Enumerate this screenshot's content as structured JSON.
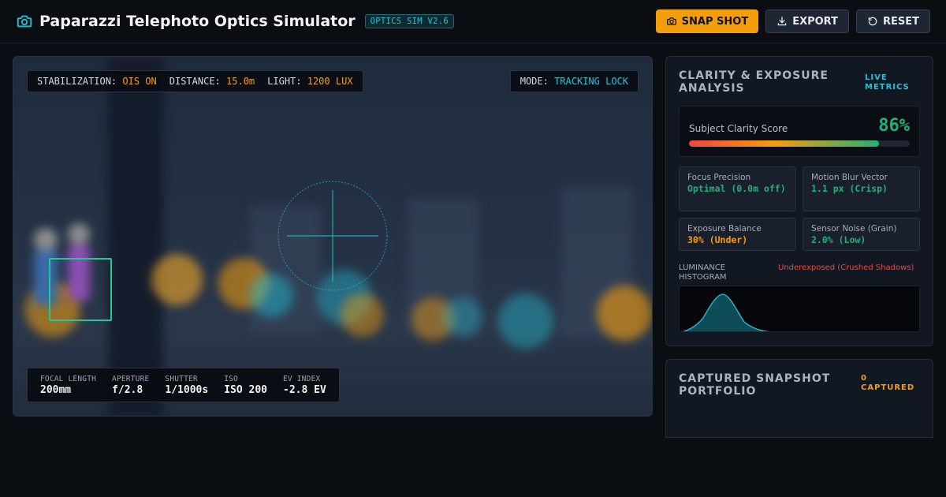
{
  "header": {
    "title": "Paparazzi Telephoto Optics Simulator",
    "version_badge": "OPTICS SIM V2.6",
    "buttons": {
      "snap": "SNAP SHOT",
      "export": "EXPORT",
      "reset": "RESET"
    }
  },
  "viewfinder": {
    "hud_top": {
      "stabilization_label": "STABILIZATION:",
      "stabilization_value": "OIS ON",
      "distance_label": "DISTANCE:",
      "distance_value": "15.0m",
      "light_label": "LIGHT:",
      "light_value": "1200 LUX"
    },
    "mode": {
      "label": "MODE:",
      "value": "TRACKING LOCK"
    },
    "exposure": [
      {
        "label": "FOCAL LENGTH",
        "value": "200mm"
      },
      {
        "label": "APERTURE",
        "value": "f/2.8"
      },
      {
        "label": "SHUTTER",
        "value": "1/1000s"
      },
      {
        "label": "ISO",
        "value": "ISO 200"
      },
      {
        "label": "EV INDEX",
        "value": "-2.8 EV"
      }
    ]
  },
  "analysis": {
    "title": "CLARITY & EXPOSURE ANALYSIS",
    "tag": "LIVE METRICS",
    "clarity_label": "Subject Clarity Score",
    "clarity_value": "86%",
    "clarity_fraction": 0.86,
    "metrics": [
      {
        "label": "Focus Precision",
        "value": "Optimal (0.0m off)",
        "color": "#22b07a"
      },
      {
        "label": "Motion Blur Vector",
        "value": "1.1 px (Crisp)",
        "color": "#22b07a"
      },
      {
        "label": "Exposure Balance",
        "value": "30% (Under)",
        "color": "#f59e0b"
      },
      {
        "label": "Sensor Noise (Grain)",
        "value": "2.0% (Low)",
        "color": "#22b07a"
      }
    ],
    "histogram_label": "LUMINANCE HISTOGRAM",
    "histogram_status": "Underexposed (Crushed Shadows)"
  },
  "portfolio": {
    "title": "CAPTURED SNAPSHOT PORTFOLIO",
    "count": "0 CAPTURED"
  },
  "colors": {
    "accent": "#f59e0b",
    "cyan": "#22c3d9",
    "good": "#22b07a",
    "warn": "#ef4444"
  }
}
